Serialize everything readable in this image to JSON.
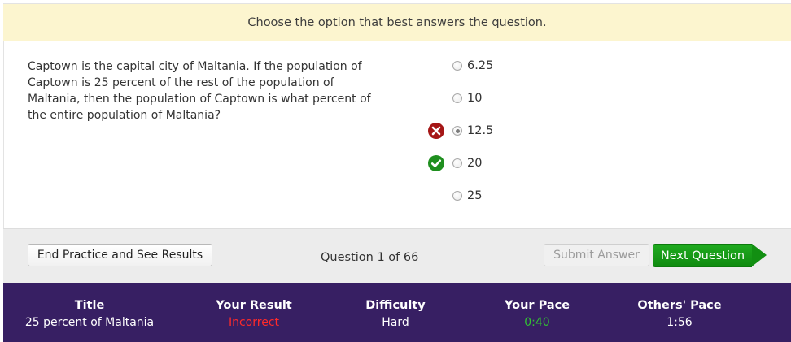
{
  "instruction": "Choose the option that best answers the question.",
  "question": {
    "text": "Captown is the capital city of Maltania. If the population of Captown is 25 percent of the rest of the population of Maltania, then the population of Captown is what percent of the entire population of Maltania?"
  },
  "options": [
    {
      "label": "6.25",
      "selected": false,
      "marker": ""
    },
    {
      "label": "10",
      "selected": false,
      "marker": ""
    },
    {
      "label": "12.5",
      "selected": true,
      "marker": "incorrect-icon"
    },
    {
      "label": "20",
      "selected": false,
      "marker": "correct-icon"
    },
    {
      "label": "25",
      "selected": false,
      "marker": ""
    }
  ],
  "actions": {
    "end_label": "End Practice and See Results",
    "counter": "Question 1 of 66",
    "submit_label": "Submit Answer",
    "next_label": "Next Question"
  },
  "stats": {
    "title_head": "Title",
    "title_value": "25 percent of Maltania",
    "result_head": "Your Result",
    "result_value": "Incorrect",
    "difficulty_head": "Difficulty",
    "difficulty_value": "Hard",
    "pace_head": "Your Pace",
    "pace_value": "0:40",
    "others_head": "Others' Pace",
    "others_value": "1:56"
  },
  "colors": {
    "instruction_bg": "#fcf5cf",
    "stats_bg": "#371f63",
    "next_button": "#129a12",
    "incorrect": "#ff2a2a",
    "pace": "#33c233",
    "incorrect_icon": "#a51616",
    "correct_icon": "#1f8f1f"
  }
}
